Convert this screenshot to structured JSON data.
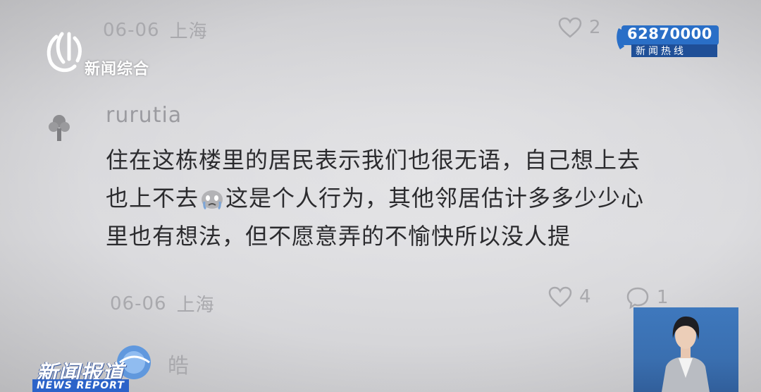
{
  "channel": {
    "name": "新闻综合"
  },
  "hotline": {
    "number": "62870000",
    "label": "新闻热线"
  },
  "program": {
    "title": "新闻报道",
    "subtitle": "NEWS REPORT"
  },
  "top_comment": {
    "date": "06-06",
    "location": "上海",
    "likes": "2"
  },
  "comment": {
    "username": "rurutia",
    "lines": [
      "住在这栋楼里的居民表示我们也很无语，自己想上去",
      [
        "也上不去",
        "这是个人行为，其他邻居估计多多少少心"
      ],
      "里也有想法，但不愿意弄的不愉快所以没人提"
    ],
    "date": "06-06",
    "location": "上海",
    "likes": "4",
    "replies": "1"
  },
  "next_comment": {
    "username": "皓"
  },
  "colors": {
    "meta": "#a9a9ad",
    "text": "#2b2b2e",
    "hotline_bg": "#2a6fc7",
    "report_band": "#2b63c9"
  }
}
